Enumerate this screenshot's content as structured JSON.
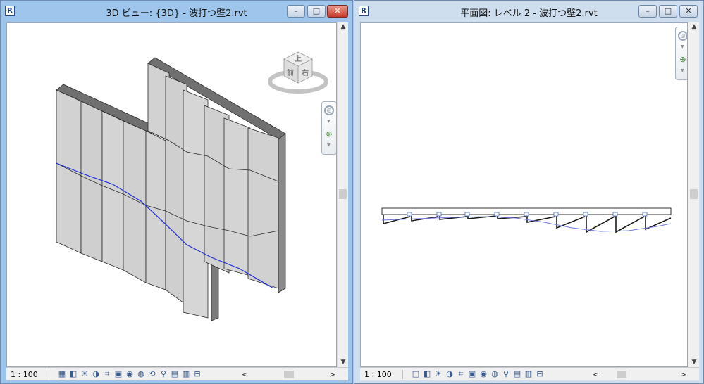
{
  "left_window": {
    "title": "3D ビュー: {3D} - 波打つ壁2.rvt",
    "scale": "1 : 100",
    "viewcube": {
      "top": "上",
      "front": "前",
      "right": "右"
    }
  },
  "right_window": {
    "title": "平面図: レベル 2 - 波打つ壁2.rvt",
    "scale": "1 : 100"
  },
  "app_icon_letter": "R",
  "window_buttons": {
    "minimize": "–",
    "maximize": "□",
    "close": "✕"
  },
  "scroll_arrows": {
    "up": "▲",
    "down": "▼",
    "left": "<",
    "right": ">"
  },
  "view_control_icons": [
    "detail-level-icon",
    "visual-style-icon",
    "sun-path-icon",
    "shadows-icon",
    "crop-view-icon",
    "show-crop-icon",
    "temporary-hide-icon",
    "reveal-hidden-icon",
    "temporary-view-properties-icon",
    "analytical-model-icon",
    "highlight-displacement-icon",
    "worksharing-display-icon",
    "temporary-hide-isolate-icon"
  ],
  "colors": {
    "curve": "#1f2fd6",
    "panel_fill": "#d4d4d4",
    "panel_stroke": "#2a2a2a",
    "wall_top": "#6e6e6e"
  }
}
